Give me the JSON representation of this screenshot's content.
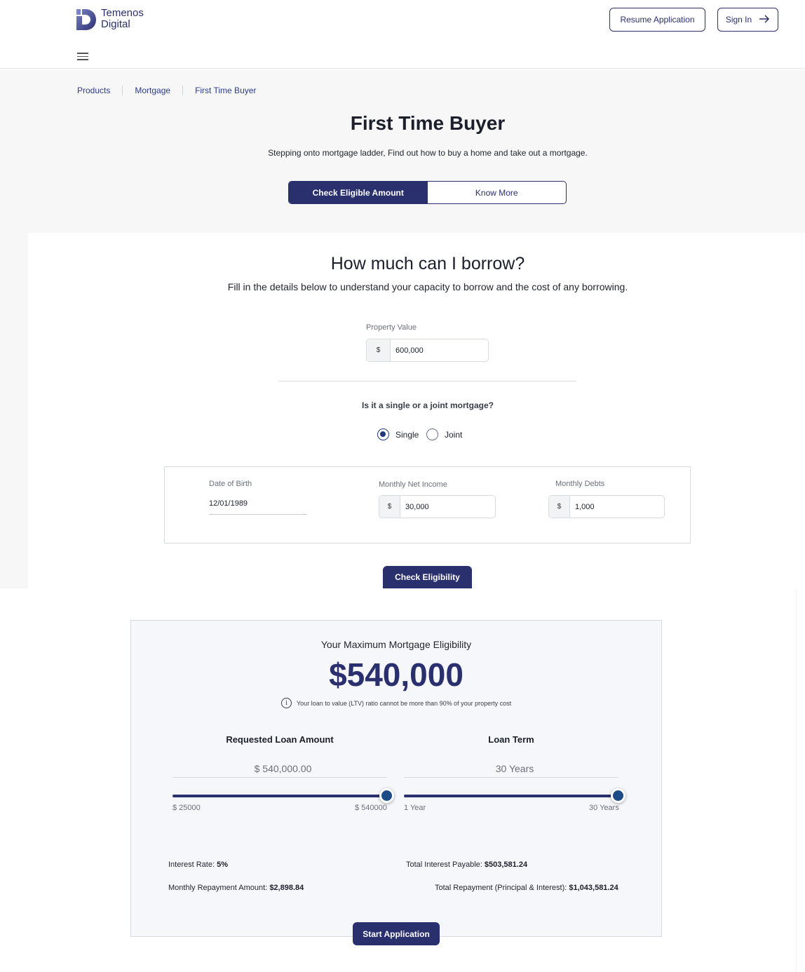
{
  "header": {
    "logo_line1": "Temenos",
    "logo_line2": "Digital",
    "resume_label": "Resume Application",
    "signin_label": "Sign In"
  },
  "breadcrumb": [
    "Products",
    "Mortgage",
    "First Time Buyer"
  ],
  "page": {
    "title": "First Time Buyer",
    "subtitle": "Stepping onto mortgage ladder, Find out how to buy a home and take out a mortgage.",
    "tabs": [
      "Check Eligible Amount",
      "Know More"
    ]
  },
  "calculator": {
    "title": "How much can I borrow?",
    "subtitle": "Fill in the details below to understand your capacity to borrow and the cost of any borrowing.",
    "property_label": "Property Value",
    "currency": "$",
    "property_value": "600,000",
    "mortgage_question": "Is it a single or a joint mortgage?",
    "options": [
      "Single",
      "Joint"
    ],
    "selected_option": "Single",
    "dob_label": "Date of Birth",
    "dob_value": "12/01/1989",
    "income_label": "Monthly Net Income",
    "income_value": "30,000",
    "debts_label": "Monthly Debts",
    "debts_value": "1,000",
    "check_button": "Check Eligibility"
  },
  "results": {
    "title": "Your Maximum Mortgage Eligibility",
    "amount": "$540,000",
    "note": "Your loan to value (LTV) ratio cannot be more than 90% of your property cost",
    "loan_amount_title": "Requested Loan Amount",
    "loan_amount_value": "$ 540,000.00",
    "loan_min": "$ 25000",
    "loan_max": "$ 540000",
    "loan_slider_fraction": 1.0,
    "term_title": "Loan Term",
    "term_value": "30 Years",
    "term_min": "1 Year",
    "term_max": "30 Years",
    "term_slider_fraction": 1.0,
    "interest_rate_label": "Interest Rate:",
    "interest_rate_value": "5%",
    "monthly_label": "Monthly Repayment Amount:",
    "monthly_value": "$2,898.84",
    "total_interest_label": "Total Interest Payable:",
    "total_interest_value": "$503,581.24",
    "total_repayment_label": "Total Repayment (Principal & Interest):",
    "total_repayment_value": "$1,043,581.24",
    "start_button": "Start Application"
  },
  "colors": {
    "primary": "#2a2f6e",
    "knob": "#1d4b85",
    "link": "#2a3a8c"
  },
  "icons": [
    "logo-icon",
    "arrow-right-icon",
    "hamburger-icon",
    "info-icon"
  ]
}
